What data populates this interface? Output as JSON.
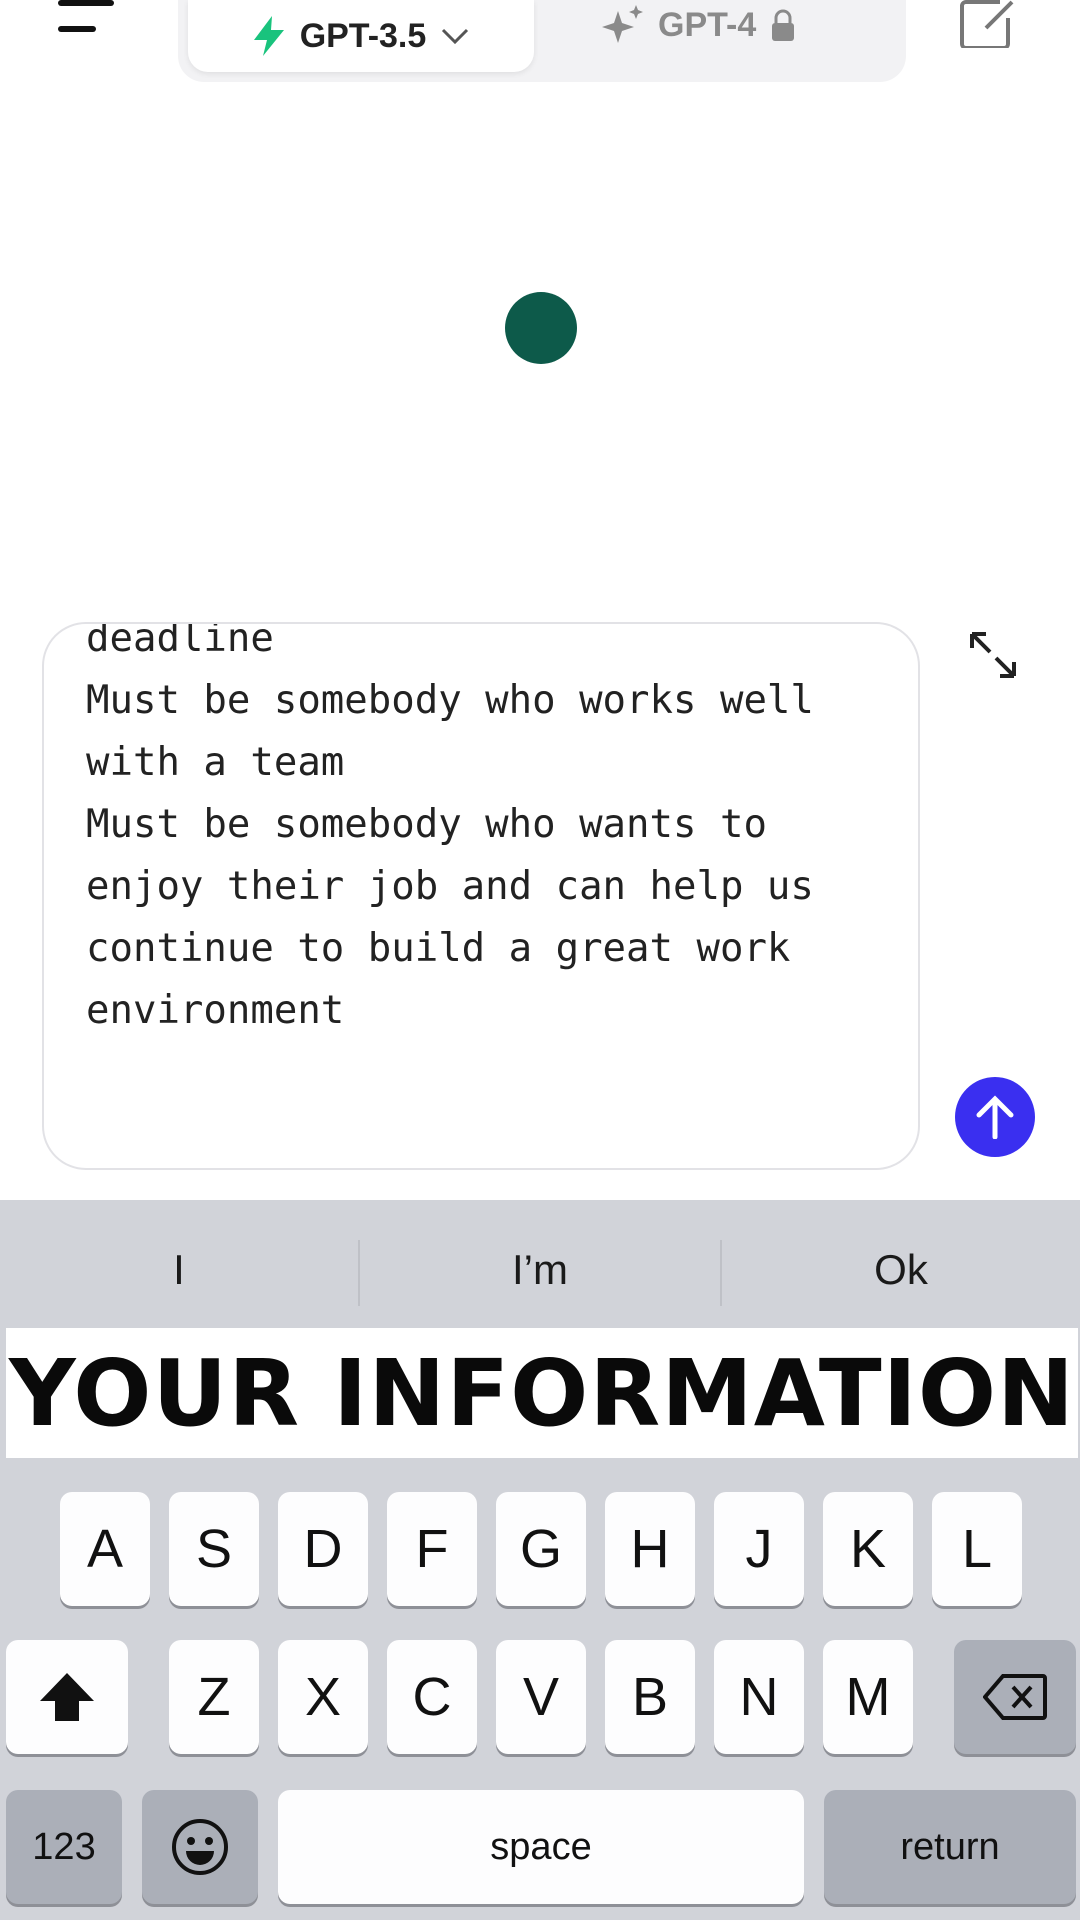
{
  "header": {
    "models": [
      {
        "label": "GPT-3.5",
        "selected": true,
        "icon": "lightning-icon"
      },
      {
        "label": "GPT-4",
        "selected": false,
        "icon": "sparkle-icon",
        "locked": true
      }
    ]
  },
  "chat": {
    "message_text": "deadline\nMust be somebody who works well with a team\nMust be somebody who wants to enjoy their job and can help us continue to build a great work environment"
  },
  "keyboard": {
    "suggestions": [
      "I",
      "I’m",
      "Ok"
    ],
    "caption_overlay": "YOUR INFORMATION",
    "row2": [
      "A",
      "S",
      "D",
      "F",
      "G",
      "H",
      "J",
      "K",
      "L"
    ],
    "row3": [
      "Z",
      "X",
      "C",
      "V",
      "B",
      "N",
      "M"
    ],
    "numbers_key": "123",
    "space_key": "space",
    "return_key": "return"
  },
  "colors": {
    "accent_green": "#19c37d",
    "send_button": "#3a2ff0",
    "thinking_dot": "#0d5a4a"
  }
}
